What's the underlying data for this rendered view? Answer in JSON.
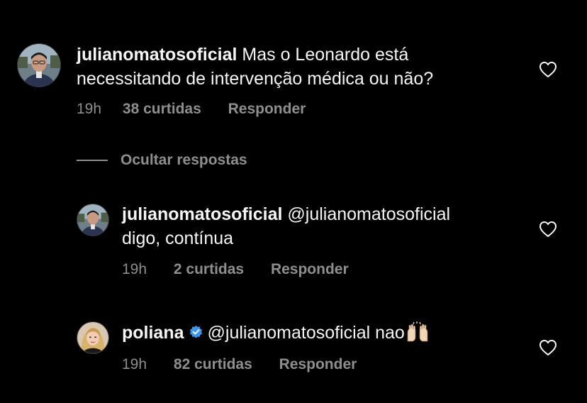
{
  "comments": [
    {
      "username": "julianomatosoficial",
      "line1": "Mas o Leonardo está",
      "line2": "necessitando de intervenção médica ou não?",
      "time": "19h",
      "likes": "38 curtidas",
      "reply": "Responder"
    }
  ],
  "hide_replies_label": "Ocultar respostas",
  "replies": [
    {
      "username": "julianomatosoficial",
      "line1": "@julianomatosoficial",
      "line2": "digo, contínua",
      "time": "19h",
      "likes": "2 curtidas",
      "reply": "Responder"
    },
    {
      "username": "poliana",
      "verified": true,
      "line1": "@julianomatosoficial nao",
      "emoji": "raising-hands-emoji",
      "time": "19h",
      "likes": "82 curtidas",
      "reply": "Responder"
    }
  ],
  "icons": {
    "like": "heart-outline-icon",
    "verified": "verified-badge-icon"
  },
  "colors": {
    "background": "#000000",
    "text": "#f5f5f5",
    "secondary": "#8e8e8e",
    "verified": "#3897f0"
  }
}
